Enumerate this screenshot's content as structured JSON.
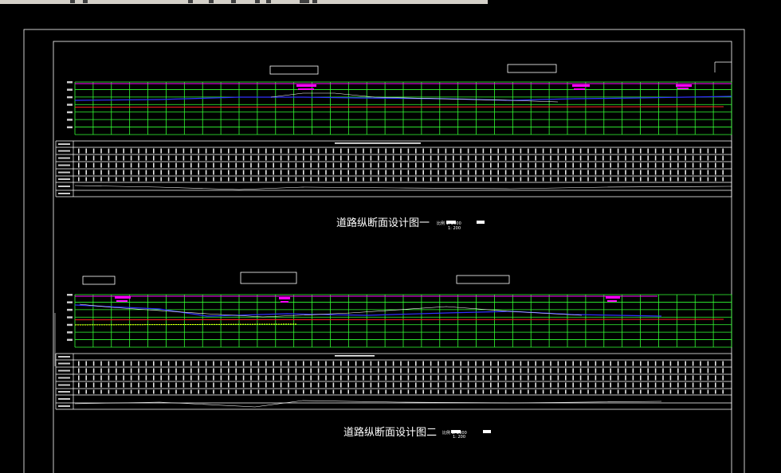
{
  "toolbar": {
    "icons": [
      "new-icon",
      "open-icon",
      "save-icon",
      "undo-icon",
      "redo-icon",
      "pan-icon",
      "zoom-icon",
      "properties-icon",
      "layer-icon"
    ]
  },
  "drawing": {
    "title1": "道路纵断面设计图一",
    "title2": "道路纵断面设计图二",
    "scale_text": "比例 1: 2000",
    "scale_sub": "1: 200"
  },
  "colors": {
    "background": "#000000",
    "grid": "#33ff33",
    "frame": "#ffffff",
    "design_line": "#ff00ff",
    "ground_line": "#ffffff",
    "profile_blue": "#3030ff",
    "profile_red": "#ff2020",
    "dashed_yellow": "#ffff00"
  }
}
